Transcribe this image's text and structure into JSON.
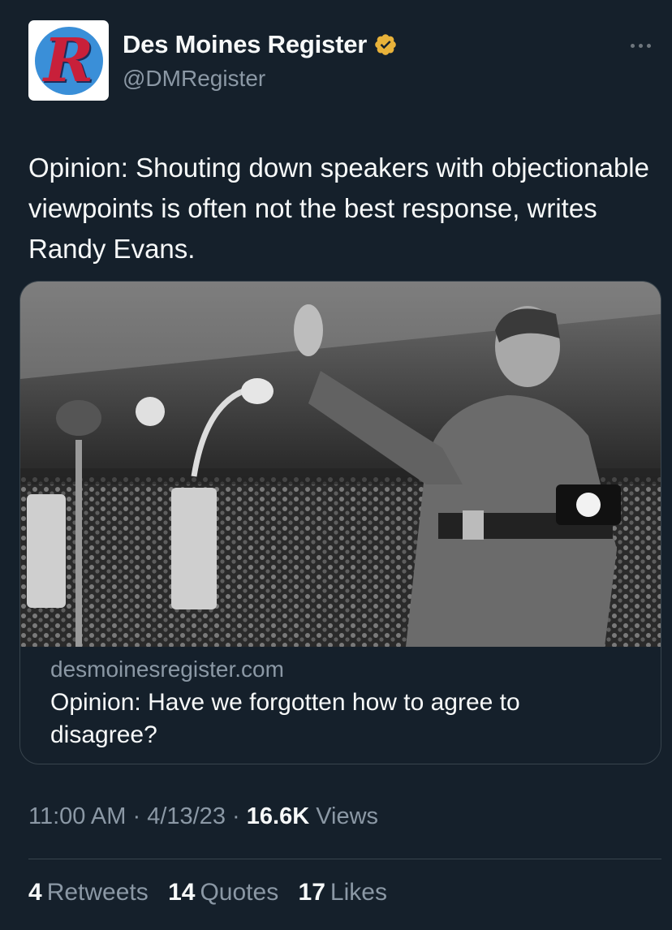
{
  "account": {
    "display_name": "Des Moines Register",
    "handle": "@DMRegister",
    "avatar_letter": "R",
    "verified_icon": "verified-badge-gold",
    "avatar_bg": "#3a8fd8",
    "avatar_letter_color": "#c8203a"
  },
  "menu": {
    "icon": "more-horizontal-icon"
  },
  "tweet": {
    "text": "Opinion: Shouting down speakers with objectionable viewpoints is often not the best response, writes Randy Evans."
  },
  "card": {
    "image_icon": "historical-black-and-white-rally-photo",
    "domain": "desmoinesregister.com",
    "title": "Opinion: Have we forgotten how to agree to disagree?"
  },
  "meta": {
    "time": "11:00 AM",
    "separator": "·",
    "date": "4/13/23",
    "views_count": "16.6K",
    "views_label": "Views"
  },
  "stats": {
    "retweets_count": "4",
    "retweets_label": "Retweets",
    "quotes_count": "14",
    "quotes_label": "Quotes",
    "likes_count": "17",
    "likes_label": "Likes"
  },
  "colors": {
    "background": "#15202b",
    "text_primary": "#f7f9f9",
    "text_secondary": "#8b98a5",
    "border": "#38444d",
    "verified": "#e8b23a"
  }
}
